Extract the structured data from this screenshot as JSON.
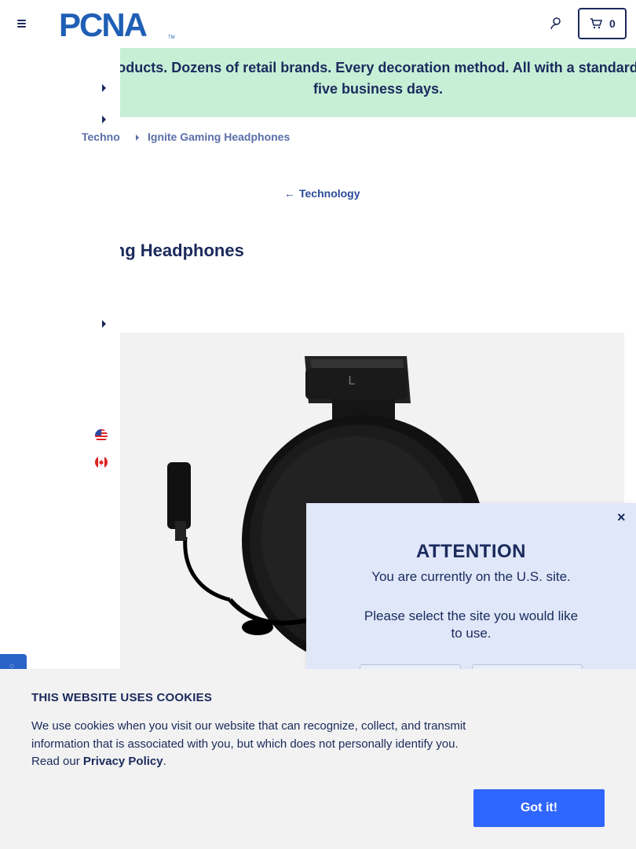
{
  "header": {
    "logo_text": "PCNA",
    "cart_count": "0"
  },
  "promo": {
    "text": "Thousands of products. Dozens of retail brands. Every decoration method. All with a standard lead time of just five business days."
  },
  "breadcrumb": {
    "previous": "Technology",
    "current": "Ignite Gaming Headphones"
  },
  "back_link": {
    "label": "Technology"
  },
  "product": {
    "title": "Ignite Gaming Headphones",
    "cup_letter": "L"
  },
  "regions": [
    {
      "name": "us-flag-icon"
    },
    {
      "name": "canada-flag-icon"
    }
  ],
  "modal": {
    "title": "ATTENTION",
    "line1": "You are currently on the U.S. site.",
    "line2": "Please select the site you would like to use.",
    "close_label": "×"
  },
  "cookie": {
    "title": "THIS WEBSITE USES COOKIES",
    "body_prefix": "We use cookies when you visit our website that can recognize, collect, and transmit information that is associated with you, but which does not personally identify you. Read our ",
    "link_text": "Privacy Policy",
    "body_suffix": ".",
    "button_label": "Got it!"
  },
  "colors": {
    "navy": "#1b2a5c",
    "promo_bg": "#c6efd6",
    "cta_blue": "#2f66ff",
    "modal_bg": "#dfe7f8"
  }
}
